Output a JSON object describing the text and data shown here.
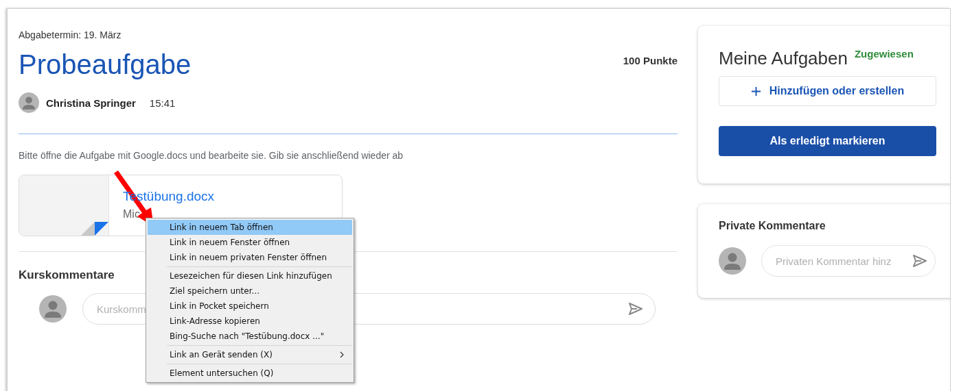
{
  "assignment": {
    "due": "Abgabetermin: 19. März",
    "title": "Probeaufgabe",
    "points": "100 Punkte",
    "author": "Christina Springer",
    "time": "15:41",
    "description": "Bitte öffne die Aufgabe mit Google.docs und bearbeite sie. Gib sie anschließend wieder ab",
    "attachment": {
      "name": "Testübung.docx",
      "type": "Mic"
    }
  },
  "class_comments": {
    "heading": "Kurskommentare",
    "placeholder": "Kurskomm"
  },
  "my_work": {
    "title": "Meine Aufgaben",
    "status": "Zugewiesen",
    "add_button": "Hinzufügen oder erstellen",
    "done_button": "Als erledigt markieren"
  },
  "private_comments": {
    "heading": "Private Kommentare",
    "placeholder": "Privaten Kommentar hinz"
  },
  "context_menu": {
    "groups": [
      [
        {
          "label": "Link in neuem Tab öffnen",
          "selected": true,
          "submenu": false
        },
        {
          "label": "Link in neuem Fenster öffnen",
          "selected": false,
          "submenu": false
        },
        {
          "label": "Link in neuem privaten Fenster öffnen",
          "selected": false,
          "submenu": false
        }
      ],
      [
        {
          "label": "Lesezeichen für diesen Link hinzufügen",
          "selected": false,
          "submenu": false
        },
        {
          "label": "Ziel speichern unter...",
          "selected": false,
          "submenu": false
        },
        {
          "label": "Link in Pocket speichern",
          "selected": false,
          "submenu": false
        },
        {
          "label": "Link-Adresse kopieren",
          "selected": false,
          "submenu": false
        },
        {
          "label": "Bing-Suche nach \"Testübung.docx ...\"",
          "selected": false,
          "submenu": false
        }
      ],
      [
        {
          "label": "Link an Gerät senden (X)",
          "selected": false,
          "submenu": true
        }
      ],
      [
        {
          "label": "Element untersuchen (Q)",
          "selected": false,
          "submenu": false
        }
      ]
    ]
  }
}
